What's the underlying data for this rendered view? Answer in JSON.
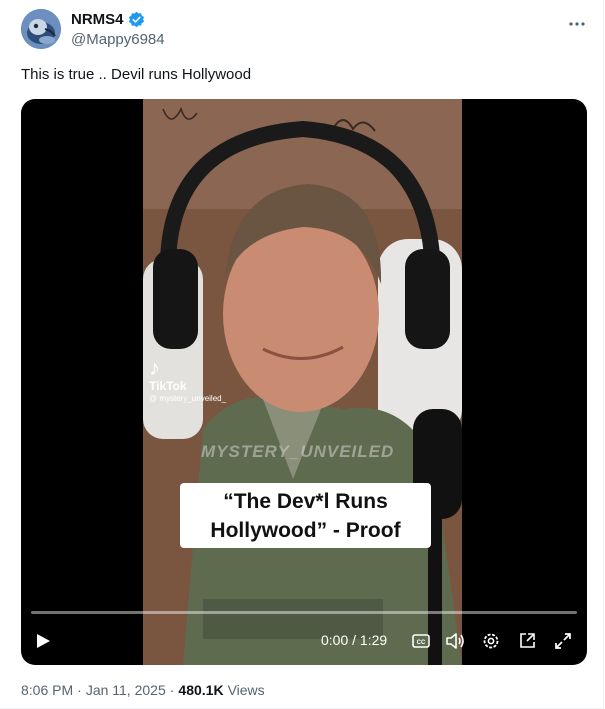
{
  "author": {
    "display_name": "NRMS4",
    "handle": "@Mappy6984",
    "verified": true,
    "avatar": "avatar-image"
  },
  "post": {
    "text": "This is true .. Devil runs Hollywood"
  },
  "video": {
    "tiktok_brand": "TikTok",
    "tiktok_user": "@ mystery_unveiled_",
    "watermark": "MYSTERY_UNVEILED",
    "caption_line1": "“The Dev*l Runs",
    "caption_line2": "Hollywood” - Proof",
    "time_display": "0:00 / 1:29",
    "progress": 0,
    "accent_color": "#1d9bf0"
  },
  "meta": {
    "time": "8:06 PM",
    "separator1": "·",
    "date": "Jan 11, 2025",
    "separator2": "·",
    "views_count": "480.1K",
    "views_label": "Views"
  },
  "icons": [
    "more-icon",
    "verified-badge-icon",
    "play-icon",
    "captions-icon",
    "volume-icon",
    "settings-icon",
    "pip-icon",
    "fullscreen-icon",
    "tiktok-logo-icon"
  ],
  "colors": {
    "text": "#0f1419",
    "secondary": "#536471",
    "verified": "#1d9bf0"
  }
}
